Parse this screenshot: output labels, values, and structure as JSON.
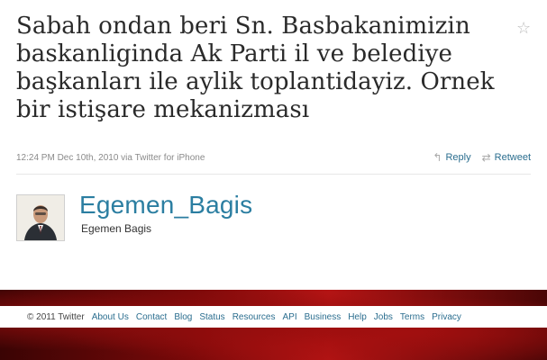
{
  "tweet": {
    "lines": [
      "Sabah ondan beri Sn. Basbakanimizin",
      "baskanliginda Ak Parti il ve belediye",
      "başkanları ile aylik toplantidayiz. Ornek",
      "bir istişare mekanizması"
    ],
    "meta": "12:24 PM Dec 10th, 2010 via Twitter for iPhone",
    "actions": {
      "reply": "Reply",
      "retweet": "Retweet"
    }
  },
  "author": {
    "username": "Egemen_Bagis",
    "name": "Egemen Bagis"
  },
  "footer": {
    "copyright": "© 2011 Twitter",
    "links": [
      "About Us",
      "Contact",
      "Blog",
      "Status",
      "Resources",
      "API",
      "Business",
      "Help",
      "Jobs",
      "Terms",
      "Privacy"
    ]
  },
  "colors": {
    "link": "#2b6e8f",
    "username": "#2b7ea1",
    "background_bottom": "#8b0b0b"
  }
}
